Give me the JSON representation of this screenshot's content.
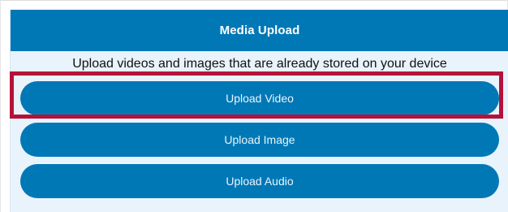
{
  "header": {
    "title": "Media Upload"
  },
  "subtitle": "Upload videos and images that are already stored on your device",
  "buttons": {
    "upload_video": "Upload Video",
    "upload_image": "Upload Image",
    "upload_audio": "Upload Audio"
  },
  "colors": {
    "header_bg": "#0178b6",
    "button_bg": "#0178b6",
    "panel_bg": "#e9f3fb",
    "highlight": "#b5123a"
  }
}
